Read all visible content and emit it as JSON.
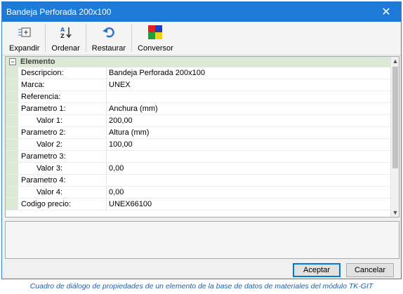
{
  "window": {
    "title": "Bandeja Perforada 200x100"
  },
  "toolbar": [
    {
      "label": "Expandir",
      "icon": "expand-icon"
    },
    {
      "label": "Ordenar",
      "icon": "sort-az-icon"
    },
    {
      "label": "Restaurar",
      "icon": "undo-icon"
    },
    {
      "label": "Conversor",
      "icon": "color-squares-icon"
    }
  ],
  "grid": {
    "category": "Elemento",
    "rows": [
      {
        "name": "Descripcion:",
        "value": "Bandeja Perforada 200x100",
        "indent": false
      },
      {
        "name": "Marca:",
        "value": "UNEX",
        "indent": false
      },
      {
        "name": "Referencia:",
        "value": "",
        "indent": false
      },
      {
        "name": "Parametro 1:",
        "value": "Anchura (mm)",
        "indent": false
      },
      {
        "name": "Valor 1:",
        "value": "200,00",
        "indent": true
      },
      {
        "name": "Parametro 2:",
        "value": "Altura (mm)",
        "indent": false
      },
      {
        "name": "Valor 2:",
        "value": "100,00",
        "indent": true
      },
      {
        "name": "Parametro 3:",
        "value": "",
        "indent": false
      },
      {
        "name": "Valor 3:",
        "value": "0,00",
        "indent": true
      },
      {
        "name": "Parametro 4:",
        "value": "",
        "indent": false
      },
      {
        "name": "Valor 4:",
        "value": "0,00",
        "indent": true
      },
      {
        "name": "Codigo precio:",
        "value": "UNEX66100",
        "indent": false
      }
    ]
  },
  "buttons": {
    "accept": "Aceptar",
    "cancel": "Cancelar"
  },
  "caption": "Cuadro de diálogo de propiedades de un elemento de la base de datos de materiales del módulo TK-GIT",
  "colors": {
    "titlebar": "#1d7ad8",
    "category_bg": "#dbe9d5",
    "caption": "#1f5fa8"
  }
}
